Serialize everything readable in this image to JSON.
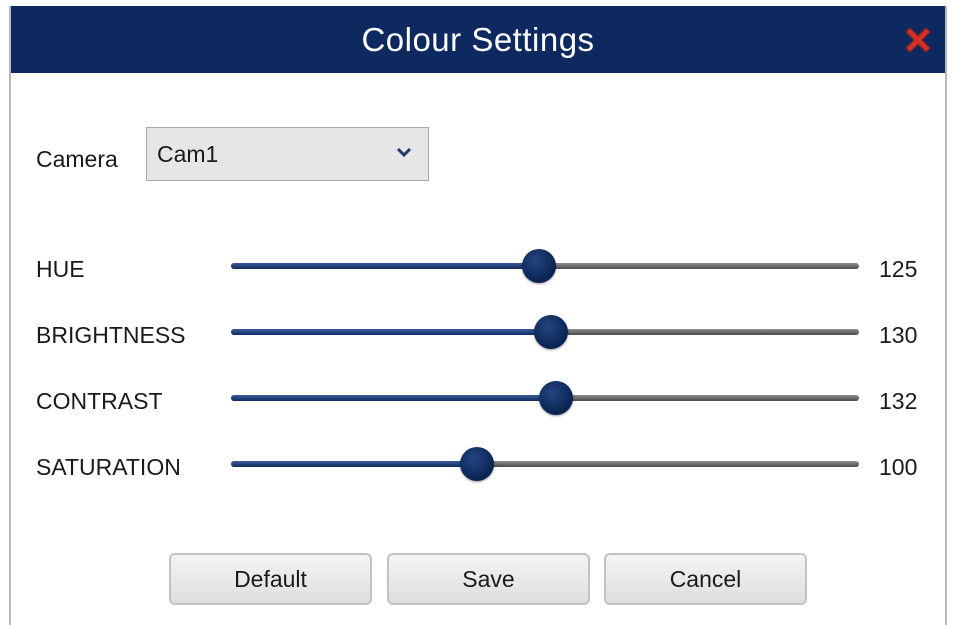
{
  "dialog": {
    "title": "Colour Settings",
    "close_icon": "close-x-icon",
    "close_color": "#d0302a",
    "title_bar_color": "#0d2960"
  },
  "camera": {
    "label": "Camera",
    "selected": "Cam1",
    "caret_icon": "chevron-down-icon"
  },
  "sliders": [
    {
      "label": "HUE",
      "value": "125",
      "level": 125
    },
    {
      "label": "BRIGHTNESS",
      "value": "130",
      "level": 130
    },
    {
      "label": "CONTRAST",
      "value": "132",
      "level": 132
    },
    {
      "label": "SATURATION",
      "value": "100",
      "level": 100
    }
  ],
  "slider_range": {
    "min": 0,
    "max": 255
  },
  "buttons": {
    "default_label": "Default",
    "save_label": "Save",
    "cancel_label": "Cancel"
  }
}
